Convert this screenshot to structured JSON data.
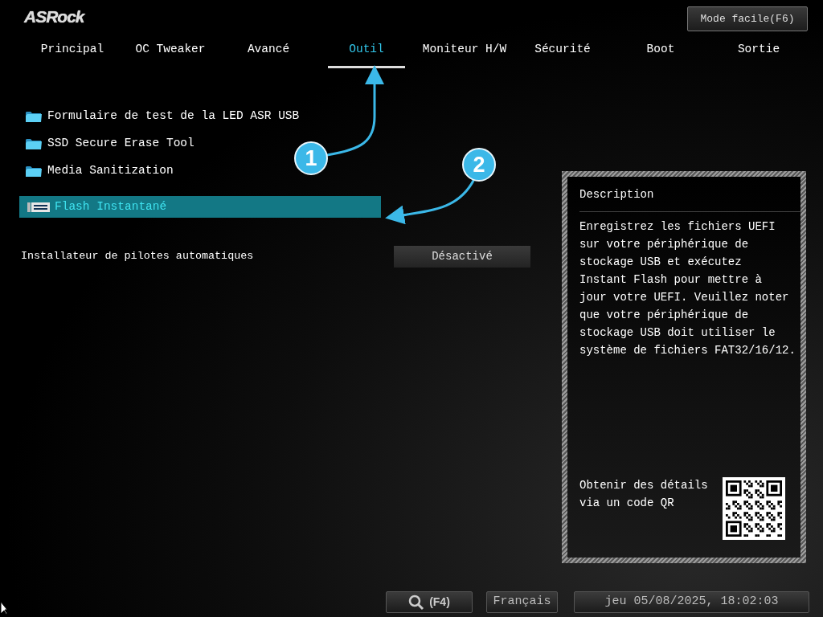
{
  "header": {
    "logo": "ASRock",
    "mode_button": "Mode facile(F6)"
  },
  "tabs": [
    {
      "label": "Principal",
      "selected": false
    },
    {
      "label": "OC Tweaker",
      "selected": false
    },
    {
      "label": "Avancé",
      "selected": false
    },
    {
      "label": "Outil",
      "selected": true
    },
    {
      "label": "Moniteur H/W",
      "selected": false
    },
    {
      "label": "Sécurité",
      "selected": false
    },
    {
      "label": "Boot",
      "selected": false
    },
    {
      "label": "Sortie",
      "selected": false
    }
  ],
  "menu_items": [
    {
      "kind": "folder",
      "label": "Formulaire de test de la LED ASR USB",
      "selected": false
    },
    {
      "kind": "folder",
      "label": "SSD Secure Erase Tool",
      "selected": false
    },
    {
      "kind": "folder",
      "label": "Media Sanitization",
      "selected": false
    },
    {
      "kind": "bios",
      "label": "Flash Instantané",
      "selected": true
    }
  ],
  "settings": [
    {
      "label": "Installateur de pilotes automatiques",
      "value": "Désactivé"
    }
  ],
  "description": {
    "title": "Description",
    "text_lines": [
      "Enregistrez les fichiers UEFI",
      "sur votre périphérique de",
      "stockage USB et exécutez",
      "Instant Flash pour mettre à",
      "jour votre UEFI. Veuillez noter",
      "que votre périphérique de",
      "stockage USB doit utiliser le",
      "système de fichiers FAT32/16/12."
    ],
    "qr_caption_lines": [
      "Obtenir des détails",
      "via un code QR"
    ]
  },
  "annotations": [
    {
      "number": "1"
    },
    {
      "number": "2"
    }
  ],
  "footer": {
    "search_key": "(F4)",
    "language": "Français",
    "datetime": "jeu 05/08/2025, 18:02:03"
  }
}
